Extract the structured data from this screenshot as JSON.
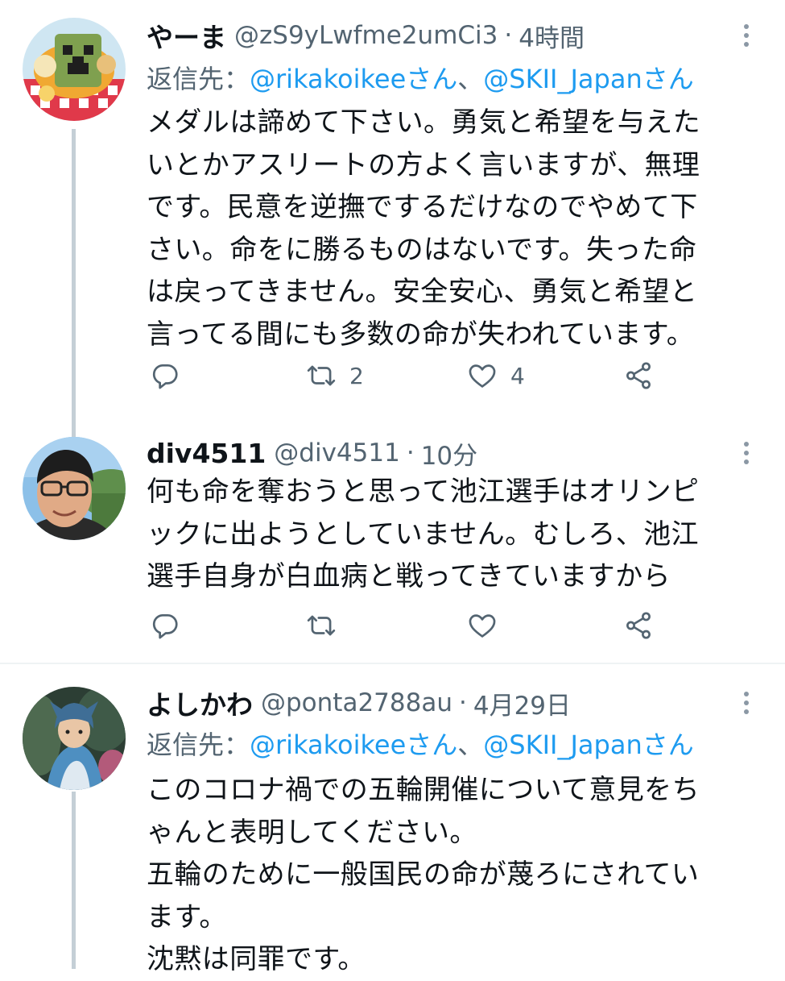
{
  "tweets": [
    {
      "name": "やーま",
      "handle": "@zS9yLwfme2umCi3",
      "time": "4時間",
      "reply_prefix": "返信先：",
      "reply_to": [
        "@rikakoikeeさん",
        "@SKII_Japanさん"
      ],
      "reply_sep": "、",
      "lines": [
        "メダルは諦めて下さい。勇気と希望を与えた",
        "いとかアスリートの方よく言いますが、無理",
        "です。民意を逆撫でするだけなのでやめて下",
        "さい。命をに勝るものはないです。失った命",
        "は戻ってきません。安全安心、勇気と希望と",
        "言ってる間にも多数の命が失われています。"
      ],
      "retweets": "2",
      "likes": "4"
    },
    {
      "name": "div4511",
      "handle": "@div4511",
      "time": "10分",
      "lines": [
        "何も命を奪おうと思って池江選手はオリンピ",
        "ックに出ようとしていません。むしろ、池江",
        "選手自身が白血病と戦ってきていますから"
      ],
      "retweets": "",
      "likes": ""
    },
    {
      "name": "よしかわ",
      "handle": "@ponta2788au",
      "time": "4月29日",
      "reply_prefix": "返信先：",
      "reply_to": [
        "@rikakoikeeさん",
        "@SKII_Japanさん"
      ],
      "reply_sep": "、",
      "lines": [
        "このコロナ禍での五輪開催について意見をち",
        "ゃんと表明してください。",
        "五輪のために一般国民の命が蔑ろにされてい",
        "ます。",
        "沈黙は同罪です。"
      ]
    }
  ],
  "icons": {
    "reply": "reply-icon",
    "retweet": "retweet-icon",
    "like": "like-icon",
    "share": "share-icon",
    "more": "more-icon"
  },
  "colors": {
    "link": "#1d9bf0",
    "secondary_text": "#536471",
    "thread_line": "#c4cfd6"
  }
}
